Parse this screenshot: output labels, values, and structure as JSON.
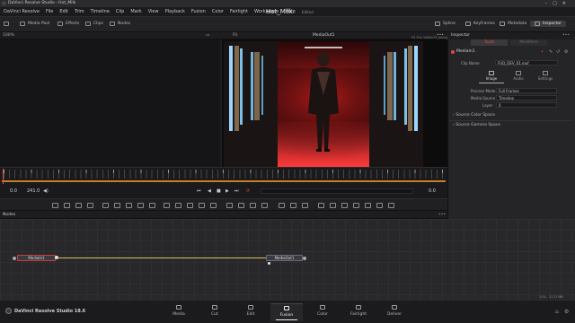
{
  "window": {
    "title": "DaVinci Resolve Studio - Hot_Milk"
  },
  "menu": {
    "items": [
      "DaVinci Resolve",
      "File",
      "Edit",
      "Trim",
      "Timeline",
      "Clip",
      "Mark",
      "View",
      "Playback",
      "Fusion",
      "Color",
      "Fairlight",
      "Workspace",
      "Help"
    ],
    "project_name": "Hot_Milk",
    "status": "Edited"
  },
  "toolbar": {
    "left": [
      "Media Pool",
      "Effects",
      "Clips",
      "Nodes"
    ],
    "right": [
      "Spline",
      "Keyframes",
      "Metadata",
      "Inspector"
    ]
  },
  "viewer": {
    "zoom": "100%",
    "fit": "Fit",
    "title": "MediaOut1",
    "resolution": "FS 25x 1080x75 [auto]"
  },
  "inspector": {
    "title": "Inspector",
    "tabs": [
      "Tools",
      "Modifiers"
    ],
    "node_name": "MediaIn1",
    "clip_name_label": "Clip Name",
    "clip_name_value": "FUD_DEV_01.mxf",
    "subtabs": [
      "Image",
      "Audio",
      "Settings"
    ],
    "process_mode_label": "Process Mode",
    "process_mode_value": "Full Frames",
    "media_source_label": "Media Source",
    "media_source_value": "Timeline",
    "layer_label": "Layer",
    "layer_value": "0",
    "sections": [
      "Source Color Space",
      "Source Gamma Space"
    ]
  },
  "transport": {
    "start_time": "0.0",
    "end_time": "241.0",
    "current_time": "0.0"
  },
  "nodes": {
    "title": "Nodes",
    "media_in": "MediaIn1",
    "media_out": "MediaOut1"
  },
  "status_bar": {
    "memory": "11% - 2172 MB"
  },
  "pagebar": {
    "brand": "DaVinci Resolve Studio 18.6",
    "pages": [
      "Media",
      "Cut",
      "Edit",
      "Fusion",
      "Color",
      "Fairlight",
      "Deliver"
    ],
    "active": "Fusion"
  },
  "colors": {
    "accent_red": "#e84b3c",
    "timeline_orange": "#c67e2a",
    "node_link": "#d8c25a"
  }
}
